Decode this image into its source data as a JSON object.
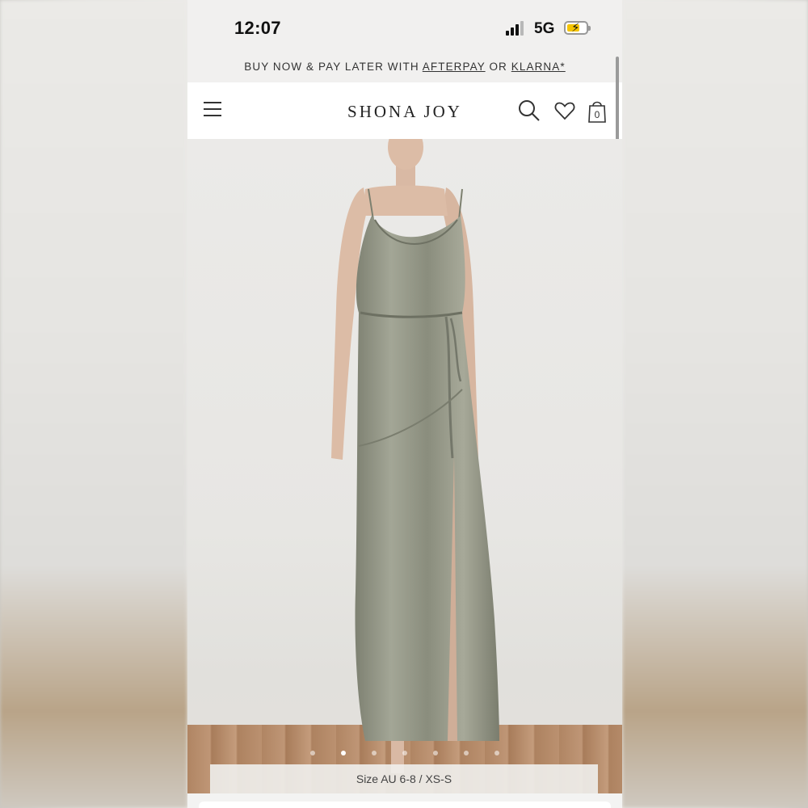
{
  "status_bar": {
    "time": "12:07",
    "network": "5G",
    "signal_bars": 4,
    "signal_bars_filled": 3,
    "battery_color": "#f5c400",
    "battery_charging": true
  },
  "promo": {
    "prefix": "BUY NOW & PAY LATER WITH ",
    "afterpay": "AFTERPAY",
    "or": " OR ",
    "klarna": "KLARNA*"
  },
  "header": {
    "brand": "SHONA JOY",
    "menu_icon": "hamburger-icon",
    "search_icon": "search-icon",
    "wishlist_icon": "heart-icon",
    "bag_icon": "shopping-bag-icon",
    "bag_count": "0"
  },
  "product": {
    "dress_color": "#8f9282",
    "size_label": "Size AU 6-8 / XS-S",
    "gallery_count": 7,
    "gallery_active_index": 1
  }
}
